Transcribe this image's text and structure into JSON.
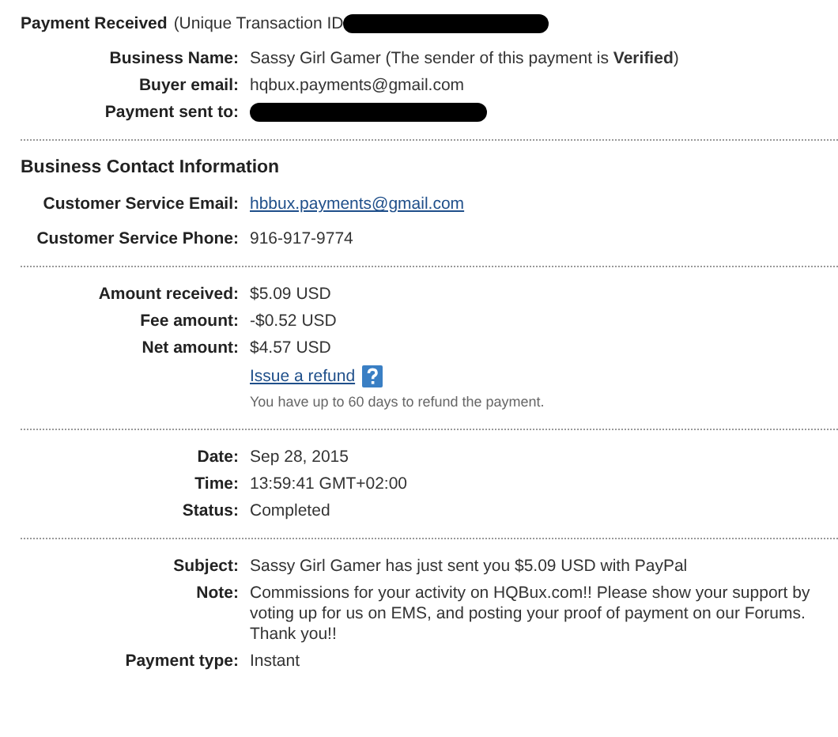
{
  "header": {
    "title": "Payment Received",
    "subtitle": "(Unique Transaction ID"
  },
  "sections": [
    {
      "rows": [
        {
          "kind": "text",
          "label": "Business Name:",
          "value": "Sassy Girl Gamer (The sender of this payment is **Verified**)"
        },
        {
          "kind": "text",
          "label": "Buyer email:",
          "value": "hqbux.payments@gmail.com"
        },
        {
          "kind": "redacted",
          "label": "Payment sent to:"
        }
      ]
    },
    {
      "heading": "Business Contact Information",
      "rows": [
        {
          "kind": "link",
          "label": "Customer Service Email:",
          "value": "hbbux.payments@gmail.com"
        },
        {
          "kind": "text",
          "label": "Customer Service Phone:",
          "value": "916-917-9774"
        }
      ]
    },
    {
      "rows": [
        {
          "kind": "text",
          "label": "Amount received:",
          "value": "$5.09 USD"
        },
        {
          "kind": "text",
          "label": "Fee amount:",
          "value": "-$0.52 USD"
        },
        {
          "kind": "text",
          "label": "Net amount:",
          "value": "$4.57 USD"
        },
        {
          "kind": "refund",
          "link": "Issue a refund",
          "hint": "You have up to 60 days to refund the payment."
        }
      ]
    },
    {
      "rows": [
        {
          "kind": "text",
          "label": "Date:",
          "value": "Sep 28, 2015"
        },
        {
          "kind": "text",
          "label": "Time:",
          "value": "13:59:41 GMT+02:00"
        },
        {
          "kind": "text",
          "label": "Status:",
          "value": "Completed"
        }
      ]
    },
    {
      "rows": [
        {
          "kind": "text",
          "label": "Subject:",
          "value": "Sassy Girl Gamer has just sent you $5.09 USD with PayPal"
        },
        {
          "kind": "text",
          "label": "Note:",
          "value": "Commissions for your activity on HQBux.com!! Please show your support by voting up for us on EMS, and posting your proof of payment on our Forums. Thank you!!"
        },
        {
          "kind": "text",
          "label": "Payment type:",
          "value": "Instant"
        }
      ]
    }
  ]
}
